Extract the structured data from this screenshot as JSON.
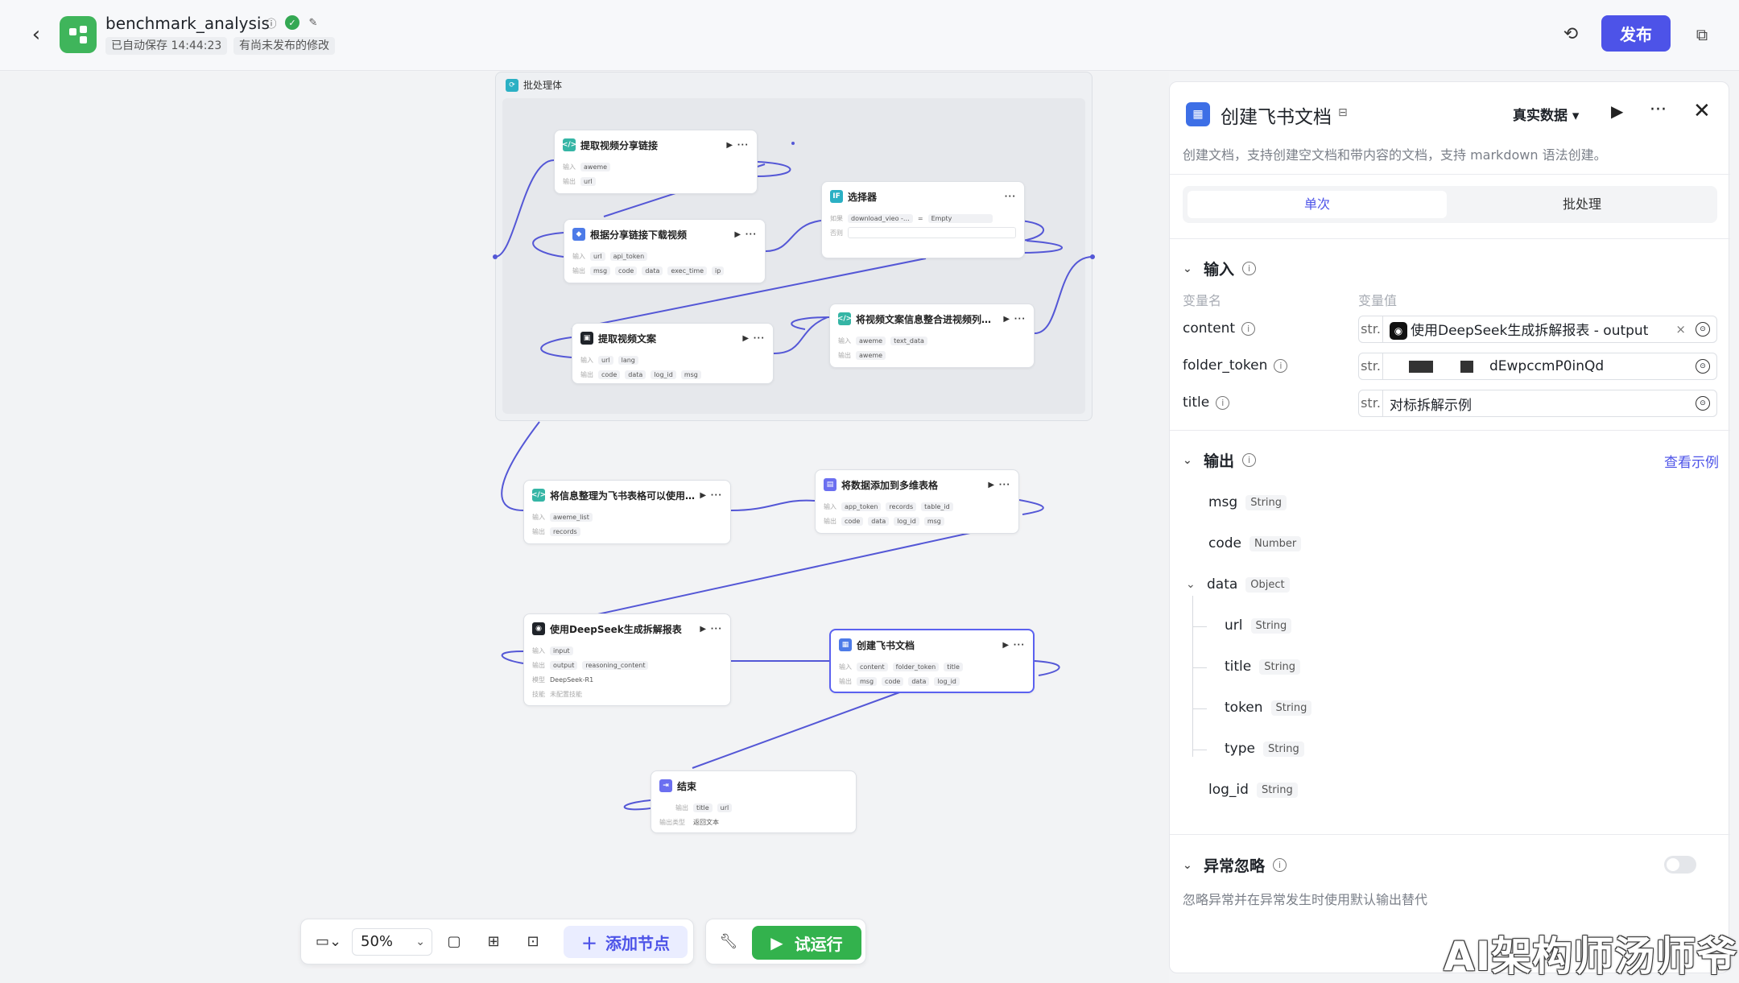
{
  "app": {
    "title": "benchmark_analysis",
    "autosave": "已自动保存 14:44:23",
    "unpublished": "有尚未发布的修改",
    "publish": "发布"
  },
  "canvas": {
    "batch_label": "批处理体",
    "nodes": [
      {
        "title": "提取视频分享链接",
        "in_label": "输入",
        "in": [
          "aweme"
        ],
        "out_label": "输出",
        "out": [
          "url"
        ]
      },
      {
        "title": "根据分享链接下载视频",
        "in_label": "输入",
        "in": [
          "url",
          "api_token"
        ],
        "out_label": "输出",
        "out": [
          "msg",
          "code",
          "data",
          "exec_time",
          "ip"
        ]
      },
      {
        "title": "选择器",
        "if_label": "如果",
        "cond_var": "download_vieo -…",
        "cond_op": "=",
        "cond_val": "Empty",
        "else_label": "否则"
      },
      {
        "title": "提取视频文案",
        "in_label": "输入",
        "in": [
          "url",
          "lang"
        ],
        "out_label": "输出",
        "out": [
          "code",
          "data",
          "log_id",
          "msg"
        ]
      },
      {
        "title": "将视频文案信息整合进视频列表中",
        "in_label": "输入",
        "in": [
          "aweme",
          "text_data"
        ],
        "out_label": "输出",
        "out": [
          "aweme"
        ]
      },
      {
        "title": "将信息整理为飞书表格可以使用…",
        "in_label": "输入",
        "in": [
          "aweme_list"
        ],
        "out_label": "输出",
        "out": [
          "records"
        ]
      },
      {
        "title": "将数据添加到多维表格",
        "in_label": "输入",
        "in": [
          "app_token",
          "records",
          "table_id"
        ],
        "out_label": "输出",
        "out": [
          "code",
          "data",
          "log_id",
          "msg"
        ]
      },
      {
        "title": "使用DeepSeek生成拆解报表",
        "in_label": "输入",
        "in": [
          "input"
        ],
        "out_label": "输出",
        "out": [
          "output",
          "reasoning_content"
        ],
        "model_label": "模型",
        "model": "DeepSeek-R1",
        "skill_label": "技能",
        "skill": "未配置技能"
      },
      {
        "title": "创建飞书文档",
        "in_label": "输入",
        "in": [
          "content",
          "folder_token",
          "title"
        ],
        "out_label": "输出",
        "out": [
          "msg",
          "code",
          "data",
          "log_id"
        ]
      },
      {
        "title": "结束",
        "out_label": "输出",
        "out": [
          "title",
          "url"
        ],
        "rt_label": "输出类型",
        "rt": "返回文本"
      }
    ]
  },
  "toolbar": {
    "zoom": "50%",
    "add_node": "添加节点",
    "run": "试运行"
  },
  "panel": {
    "title": "创建飞书文档",
    "data_mode": "真实数据",
    "description": "创建文档，支持创建空文档和带内容的文档，支持 markdown 语法创建。",
    "tabs": [
      "单次",
      "批处理"
    ],
    "input_title": "输入",
    "col_name": "变量名",
    "col_value": "变量值",
    "inputs": [
      {
        "name": "content",
        "type": "str.",
        "value": "使用DeepSeek生成拆解报表 - output"
      },
      {
        "name": "folder_token",
        "type": "str.",
        "value": "dEwpccmP0inQd"
      },
      {
        "name": "title",
        "type": "str.",
        "value": "对标拆解示例"
      }
    ],
    "output_title": "输出",
    "view_example": "查看示例",
    "outputs": [
      {
        "name": "msg",
        "type": "String"
      },
      {
        "name": "code",
        "type": "Number"
      },
      {
        "name": "data",
        "type": "Object"
      },
      {
        "name": "url",
        "type": "String"
      },
      {
        "name": "title",
        "type": "String"
      },
      {
        "name": "token",
        "type": "String"
      },
      {
        "name": "type",
        "type": "String"
      },
      {
        "name": "log_id",
        "type": "String"
      }
    ],
    "ignore_title": "异常忽略",
    "ignore_desc": "忽略异常并在异常发生时使用默认输出替代"
  },
  "watermark": "AI架构师汤师爷"
}
